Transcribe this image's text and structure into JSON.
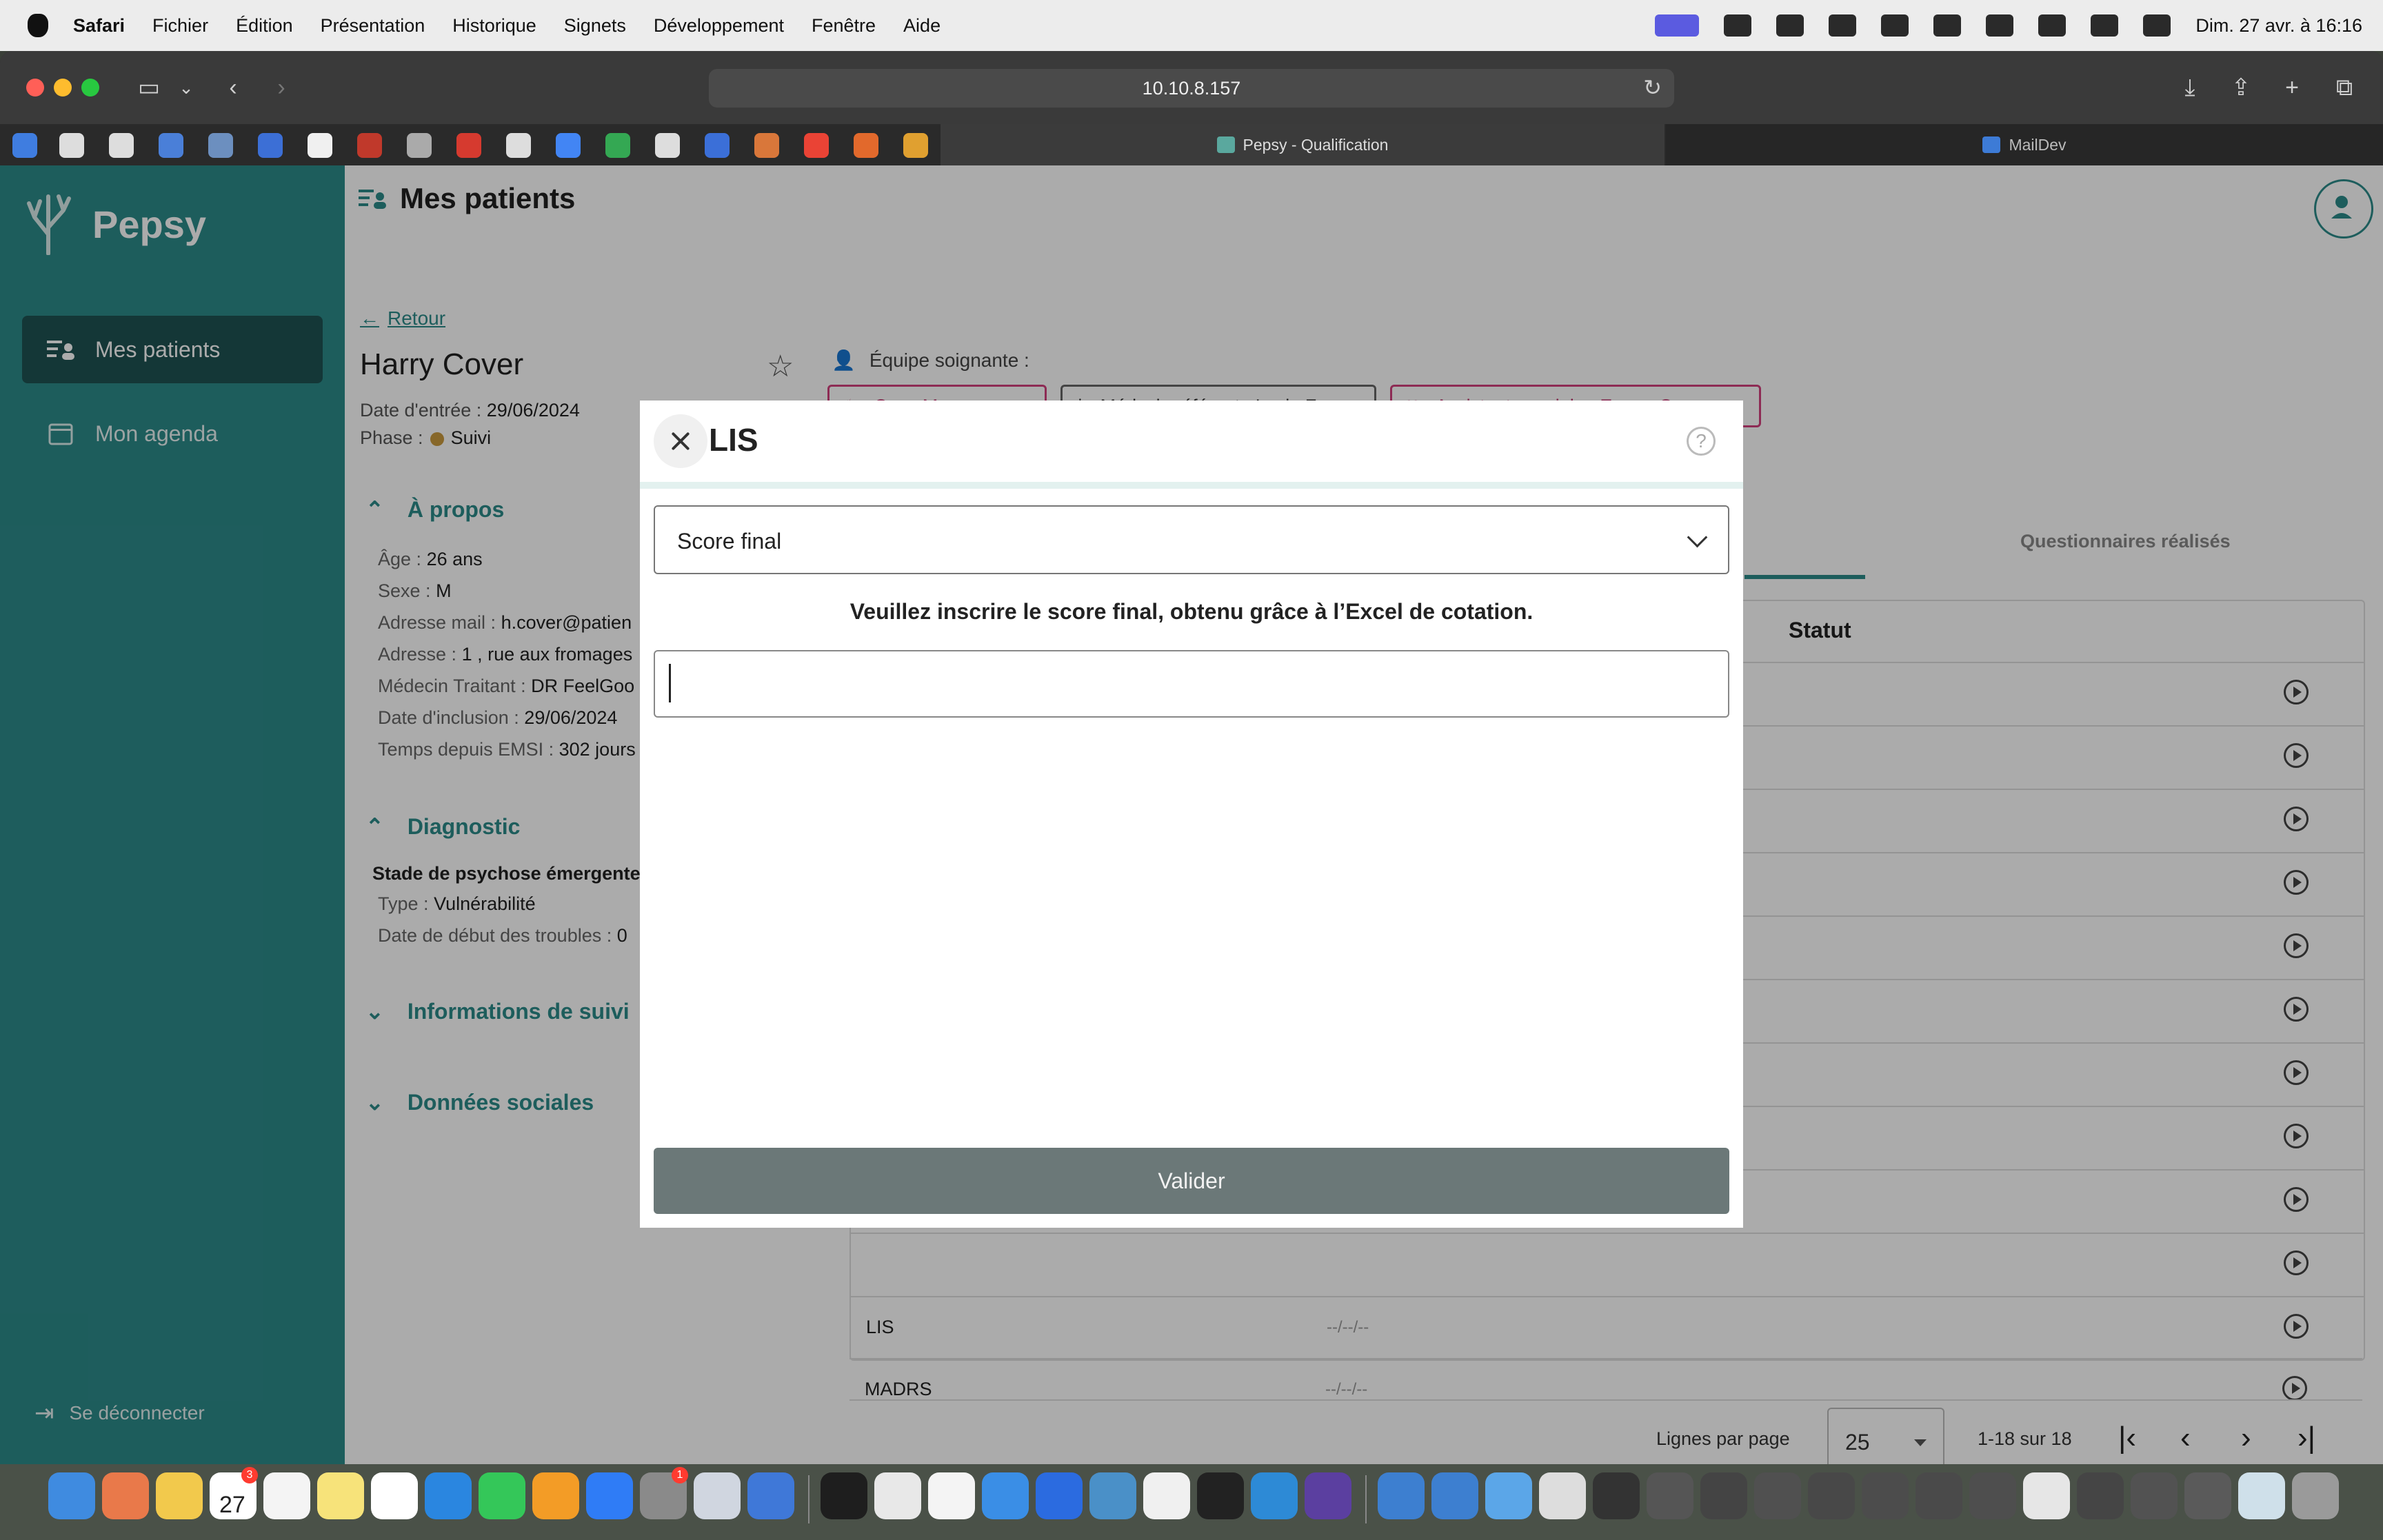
{
  "menubar": {
    "app": "Safari",
    "items": [
      "Fichier",
      "Édition",
      "Présentation",
      "Historique",
      "Signets",
      "Développement",
      "Fenêtre",
      "Aide"
    ],
    "clock": "Dim. 27 avr. à 16:16"
  },
  "browser": {
    "url": "10.10.8.157",
    "tabs": [
      {
        "label": "Pepsy - Qualification",
        "active": true
      },
      {
        "label": "MailDev",
        "active": false
      }
    ]
  },
  "sidebar": {
    "brand": "Pepsy",
    "items": [
      {
        "label": "Mes patients",
        "active": true
      },
      {
        "label": "Mon agenda",
        "active": false
      }
    ],
    "logout": "Se déconnecter"
  },
  "header": {
    "title": "Mes patients"
  },
  "patient": {
    "back_label": "Retour",
    "name": "Harry Cover",
    "entry_label": "Date d'entrée :",
    "entry_date": "29/06/2024",
    "phase_label": "Phase :",
    "phase": "Suivi",
    "about_title": "À propos",
    "about": [
      {
        "label": "Âge :",
        "value": "26 ans"
      },
      {
        "label": "Sexe :",
        "value": "M"
      },
      {
        "label": "Adresse mail :",
        "value": "h.cover@patien"
      },
      {
        "label": "Adresse :",
        "value": "1 , rue aux fromages"
      },
      {
        "label": "Médecin Traitant :",
        "value": "DR FeelGoo"
      },
      {
        "label": "Date d'inclusion :",
        "value": "29/06/2024"
      },
      {
        "label": "Temps depuis EMSI :",
        "value": "302 jours"
      }
    ],
    "diagnostic_title": "Diagnostic",
    "diagnostic_stage": "Stade de psychose émergente",
    "diagnostic_type_label": "Type :",
    "diagnostic_type": "Vulnérabilité",
    "diagnostic_start_label": "Date de début des troubles :",
    "diagnostic_start": "0",
    "suivi_title": "Informations de suivi",
    "social_title": "Données sociales"
  },
  "team": {
    "label": "Équipe soignante :",
    "chips": [
      "Case Manager :",
      "Médecin référent : Lucie Fer",
      "Assistante sociale : Emma Carena"
    ]
  },
  "questionnaires": {
    "tab_done": "Questionnaires réalisés",
    "col_statut": "Statut",
    "visible_rows": [
      {
        "name": "LIS",
        "date": "--/--/--"
      },
      {
        "name": "MADRS",
        "date": "--/--/--"
      }
    ],
    "rows_per_page_label": "Lignes par page",
    "rows_per_page": "25",
    "range": "1-18 sur 18"
  },
  "modal": {
    "title": "LIS",
    "help": "?",
    "select_value": "Score final",
    "instruction": "Veuillez inscrire le score final, obtenu grâce à l’Excel de cotation.",
    "input_value": "",
    "submit_label": "Valider"
  },
  "dock": {
    "calendar_day": "27",
    "calendar_month": "AVR.",
    "badge_calendar": "3",
    "badge_settings": "1"
  },
  "colors": {
    "accent": "#2c8b8a",
    "pink": "#d2407e",
    "submit": "#6b7878"
  }
}
